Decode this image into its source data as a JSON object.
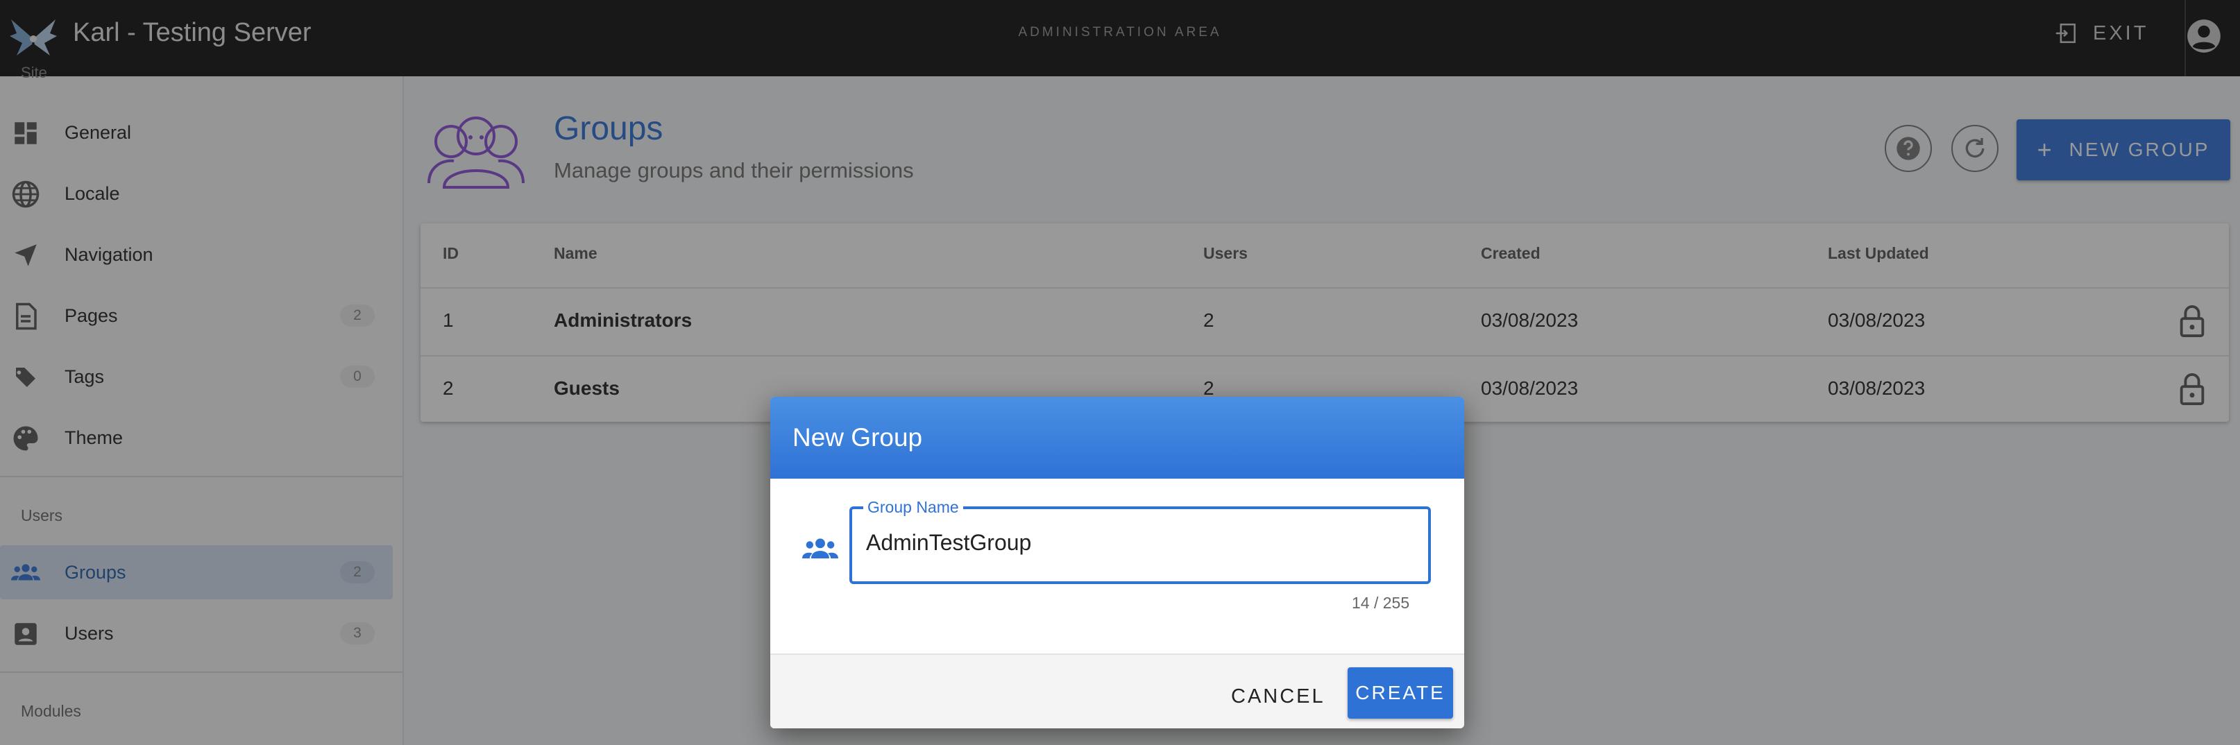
{
  "topbar": {
    "app_title": "Karl - Testing Server",
    "area_label": "ADMINISTRATION AREA",
    "exit_label": "EXIT"
  },
  "sidebar": {
    "cut_section": "Site",
    "site_items": [
      {
        "label": "General",
        "icon": "dashboard-icon"
      },
      {
        "label": "Locale",
        "icon": "globe-icon"
      },
      {
        "label": "Navigation",
        "icon": "navigation-arrow-icon"
      },
      {
        "label": "Pages",
        "icon": "document-icon",
        "count": "2"
      },
      {
        "label": "Tags",
        "icon": "tags-icon",
        "count": "0"
      },
      {
        "label": "Theme",
        "icon": "palette-icon"
      }
    ],
    "users_header": "Users",
    "users_items": [
      {
        "label": "Groups",
        "icon": "groups-icon",
        "count": "2",
        "active": true
      },
      {
        "label": "Users",
        "icon": "user-card-icon",
        "count": "3"
      }
    ],
    "modules_header": "Modules"
  },
  "main": {
    "title": "Groups",
    "subtitle": "Manage groups and their permissions",
    "new_group_label": "NEW GROUP",
    "table": {
      "headers": [
        "ID",
        "Name",
        "Users",
        "Created",
        "Last Updated"
      ],
      "rows": [
        {
          "id": "1",
          "name": "Administrators",
          "users": "2",
          "created": "03/08/2023",
          "updated": "03/08/2023"
        },
        {
          "id": "2",
          "name": "Guests",
          "users": "2",
          "created": "03/08/2023",
          "updated": "03/08/2023"
        }
      ]
    }
  },
  "dialog": {
    "title": "New Group",
    "field_label": "Group Name",
    "field_value": "AdminTestGroup",
    "counter": "14 / 255",
    "cancel_label": "CANCEL",
    "create_label": "CREATE"
  },
  "colors": {
    "accent": "#2f72d6",
    "topbar": "#121212",
    "active_nav_bg": "#d6e2f3"
  }
}
